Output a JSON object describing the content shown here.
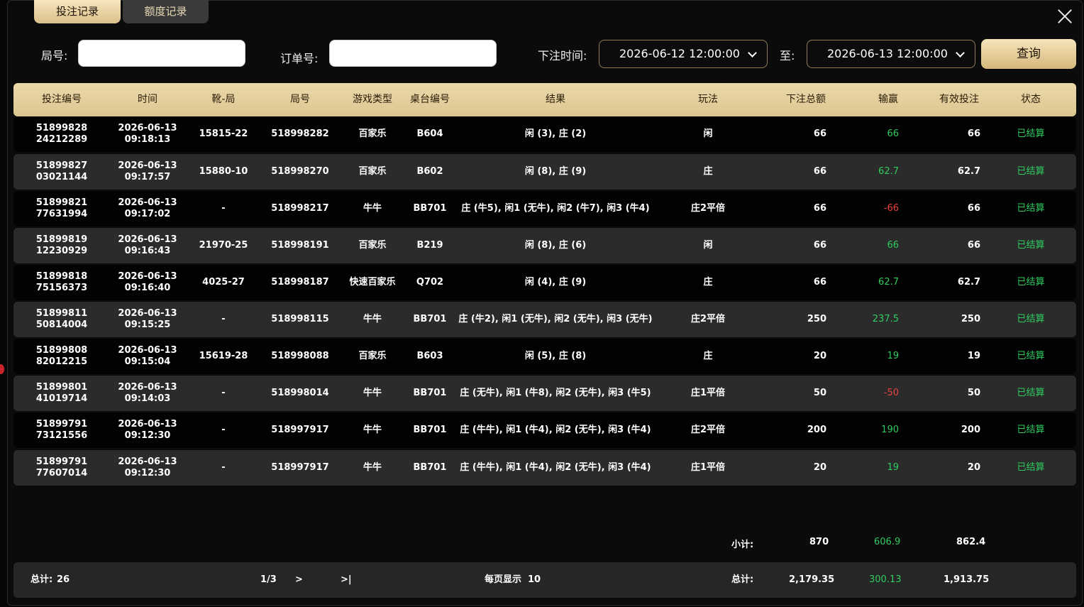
{
  "tabs": {
    "bet_records": "投注记录",
    "credit_records": "额度记录"
  },
  "filters": {
    "round_label": "局号:",
    "order_label": "订单号:",
    "time_label": "下注时间:",
    "start_time": "2026-06-12 12:00:00",
    "to_label": "至:",
    "end_time": "2026-06-13 12:00:00",
    "query_button": "查询"
  },
  "columns": [
    "投注编号",
    "时间",
    "靴-局",
    "局号",
    "游戏类型",
    "桌台编号",
    "结果",
    "玩法",
    "下注总额",
    "输赢",
    "有效投注",
    "状态"
  ],
  "rows": [
    {
      "id1": "51899828",
      "id2": "24212289",
      "date": "2026-06-13",
      "time": "09:18:13",
      "shoe": "15815-22",
      "round": "518998282",
      "game": "百家乐",
      "table": "B604",
      "result": "闲 (3), 庄 (2)",
      "play": "闲",
      "bet": "66",
      "win": "66",
      "valid": "66",
      "status": "已结算"
    },
    {
      "id1": "51899827",
      "id2": "03021144",
      "date": "2026-06-13",
      "time": "09:17:57",
      "shoe": "15880-10",
      "round": "518998270",
      "game": "百家乐",
      "table": "B602",
      "result": "闲 (8), 庄 (9)",
      "play": "庄",
      "bet": "66",
      "win": "62.7",
      "valid": "62.7",
      "status": "已结算"
    },
    {
      "id1": "51899821",
      "id2": "77631994",
      "date": "2026-06-13",
      "time": "09:17:02",
      "shoe": "-",
      "round": "518998217",
      "game": "牛牛",
      "table": "BB701",
      "result": "庄 (牛5), 闲1 (无牛), 闲2 (牛7), 闲3 (牛4)",
      "play": "庄2平倍",
      "bet": "66",
      "win": "-66",
      "valid": "66",
      "status": "已结算"
    },
    {
      "id1": "51899819",
      "id2": "12230929",
      "date": "2026-06-13",
      "time": "09:16:43",
      "shoe": "21970-25",
      "round": "518998191",
      "game": "百家乐",
      "table": "B219",
      "result": "闲 (8), 庄 (6)",
      "play": "闲",
      "bet": "66",
      "win": "66",
      "valid": "66",
      "status": "已结算"
    },
    {
      "id1": "51899818",
      "id2": "75156373",
      "date": "2026-06-13",
      "time": "09:16:40",
      "shoe": "4025-27",
      "round": "518998187",
      "game": "快速百家乐",
      "table": "Q702",
      "result": "闲 (4), 庄 (9)",
      "play": "庄",
      "bet": "66",
      "win": "62.7",
      "valid": "62.7",
      "status": "已结算"
    },
    {
      "id1": "51899811",
      "id2": "50814004",
      "date": "2026-06-13",
      "time": "09:15:25",
      "shoe": "-",
      "round": "518998115",
      "game": "牛牛",
      "table": "BB701",
      "result": "庄 (牛2), 闲1 (无牛), 闲2 (无牛), 闲3 (无牛)",
      "play": "庄2平倍",
      "bet": "250",
      "win": "237.5",
      "valid": "250",
      "status": "已结算"
    },
    {
      "id1": "51899808",
      "id2": "82012215",
      "date": "2026-06-13",
      "time": "09:15:04",
      "shoe": "15619-28",
      "round": "518998088",
      "game": "百家乐",
      "table": "B603",
      "result": "闲 (5), 庄 (8)",
      "play": "庄",
      "bet": "20",
      "win": "19",
      "valid": "19",
      "status": "已结算"
    },
    {
      "id1": "51899801",
      "id2": "41019714",
      "date": "2026-06-13",
      "time": "09:14:03",
      "shoe": "-",
      "round": "518998014",
      "game": "牛牛",
      "table": "BB701",
      "result": "庄 (无牛), 闲1 (牛8), 闲2 (无牛), 闲3 (牛5)",
      "play": "庄1平倍",
      "bet": "50",
      "win": "-50",
      "valid": "50",
      "status": "已结算"
    },
    {
      "id1": "51899791",
      "id2": "73121556",
      "date": "2026-06-13",
      "time": "09:12:30",
      "shoe": "-",
      "round": "518997917",
      "game": "牛牛",
      "table": "BB701",
      "result": "庄 (牛牛), 闲1 (牛4), 闲2 (无牛), 闲3 (牛4)",
      "play": "庄2平倍",
      "bet": "200",
      "win": "190",
      "valid": "200",
      "status": "已结算"
    },
    {
      "id1": "51899791",
      "id2": "77607014",
      "date": "2026-06-13",
      "time": "09:12:30",
      "shoe": "-",
      "round": "518997917",
      "game": "牛牛",
      "table": "BB701",
      "result": "庄 (牛牛), 闲1 (牛4), 闲2 (无牛), 闲3 (牛4)",
      "play": "庄1平倍",
      "bet": "20",
      "win": "19",
      "valid": "20",
      "status": "已结算"
    }
  ],
  "subtotal": {
    "label": "小计:",
    "bet": "870",
    "win": "606.9",
    "valid": "862.4"
  },
  "footer": {
    "count_label": "总计:",
    "count": "26",
    "page": "1/3",
    "next": ">",
    "last": ">|",
    "per_page_label": "每页显示",
    "per_page": "10",
    "total_label": "总计:",
    "bet": "2,179.35",
    "win": "300.13",
    "valid": "1,913.75"
  },
  "colors": {
    "gold": "#e6cf9c",
    "win": "#2ecc5f",
    "loss": "#e84040"
  }
}
